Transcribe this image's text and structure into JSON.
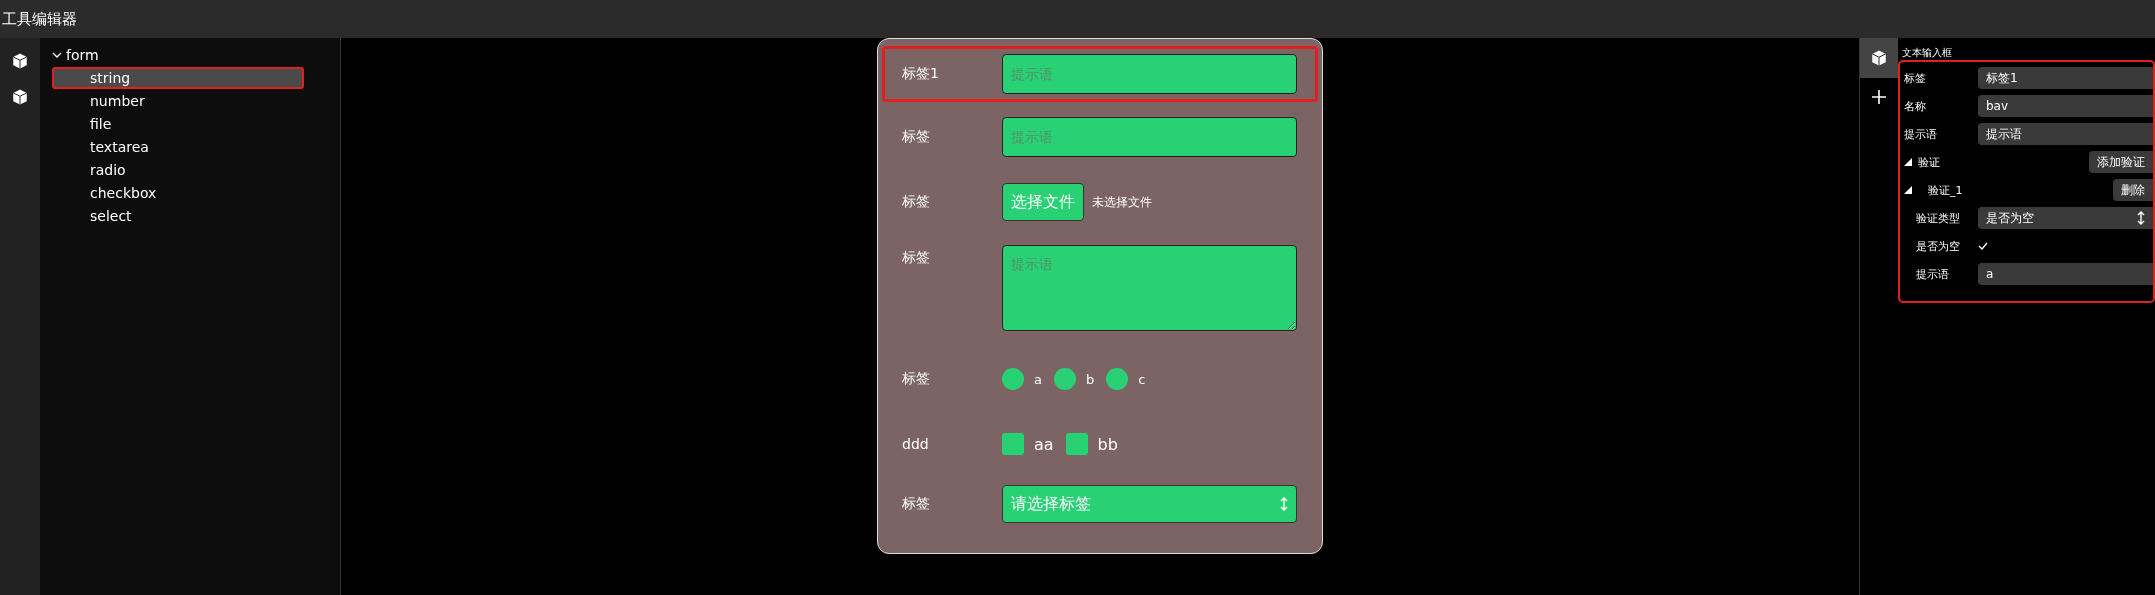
{
  "window": {
    "title": "工具编辑器"
  },
  "tree": {
    "label": "form",
    "expanded": true,
    "children": [
      {
        "label": "string",
        "selected": true,
        "highlighted": true
      },
      {
        "label": "number",
        "selected": false,
        "highlighted": false
      },
      {
        "label": "file",
        "selected": false,
        "highlighted": false
      },
      {
        "label": "textarea",
        "selected": false,
        "highlighted": false
      },
      {
        "label": "radio",
        "selected": false,
        "highlighted": false
      },
      {
        "label": "checkbox",
        "selected": false,
        "highlighted": false
      },
      {
        "label": "select",
        "selected": false,
        "highlighted": false
      }
    ]
  },
  "form": [
    {
      "kind": "text",
      "label": "标签1",
      "placeholder": "提示语",
      "highlighted": true
    },
    {
      "kind": "text",
      "label": "标签",
      "placeholder": "提示语",
      "highlighted": false
    },
    {
      "kind": "file",
      "label": "标签",
      "button": "选择文件",
      "status": "未选择文件",
      "highlighted": false
    },
    {
      "kind": "textarea",
      "label": "标签",
      "placeholder": "提示语",
      "highlighted": false
    },
    {
      "kind": "radio",
      "label": "标签",
      "highlighted": false,
      "options": [
        {
          "label": "a",
          "selected": false
        },
        {
          "label": "b",
          "selected": false
        },
        {
          "label": "c",
          "selected": false
        }
      ]
    },
    {
      "kind": "checkbox",
      "label": "ddd",
      "highlighted": false,
      "options": [
        {
          "label": "aa",
          "checked": false
        },
        {
          "label": "bb",
          "checked": false
        }
      ]
    },
    {
      "kind": "select",
      "label": "标签",
      "value": "请选择标签",
      "highlighted": false
    }
  ],
  "properties": {
    "title": "文本输入框",
    "highlighted": true,
    "rows": [
      {
        "kind": "field",
        "label": "标签",
        "value": "标签1"
      },
      {
        "kind": "field",
        "label": "名称",
        "value": "bav"
      },
      {
        "kind": "field",
        "label": "提示语",
        "value": "提示语"
      },
      {
        "kind": "group",
        "label": "验证",
        "expanded": true,
        "button": "添加验证"
      },
      {
        "kind": "subgroup",
        "label": "验证_1",
        "expanded": true,
        "button": "删除"
      },
      {
        "kind": "select",
        "label": "验证类型",
        "value": "是否为空"
      },
      {
        "kind": "check",
        "label": "是否为空",
        "checked": true
      },
      {
        "kind": "subfield",
        "label": "提示语",
        "value": "a"
      }
    ]
  }
}
